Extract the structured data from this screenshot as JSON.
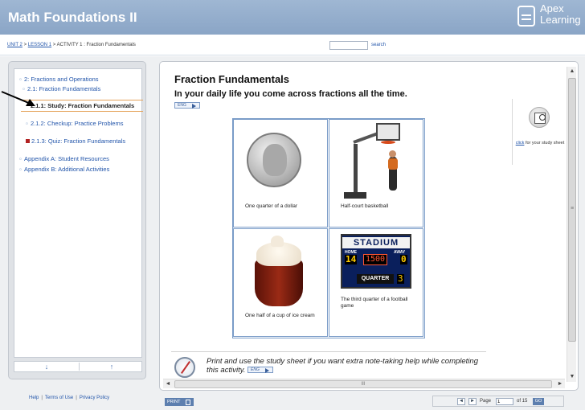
{
  "header": {
    "title": "Math Foundations II",
    "logo_line1": "Apex",
    "logo_line2": "Learning",
    "brand_color": "#8aa5c6"
  },
  "breadcrumb": {
    "unit": "UNIT 2",
    "lesson": "LESSON 1",
    "activity": "ACTIVITY 1 : Fraction Fundamentals",
    "sep": " > "
  },
  "search": {
    "placeholder": "",
    "label": "search"
  },
  "toc": {
    "items": [
      {
        "label": "2: Fractions and Operations"
      },
      {
        "label": "2.1: Fraction Fundamentals"
      },
      {
        "label": "2.1.1: Study: Fraction Fundamentals"
      },
      {
        "label": "2.1.2: Checkup: Practice Problems"
      },
      {
        "label": "2.1.3: Quiz: Fraction Fundamentals"
      },
      {
        "label": "Appendix A: Student Resources"
      },
      {
        "label": "Appendix B: Additional Activities"
      }
    ],
    "nav_down": "↓",
    "nav_up": "↑"
  },
  "footer": {
    "help": "Help",
    "terms": "Terms of Use",
    "privacy": "Privacy Policy",
    "sep": "|"
  },
  "content": {
    "title": "Fraction Fundamentals",
    "intro": "In your daily life you come across fractions all the time.",
    "eng_label": "ENG",
    "study_link": "click",
    "study_text": " for your study sheet",
    "captions": [
      "One quarter of a dollar",
      "Half-court basketball",
      "One half of a cup of ice cream",
      "The third quarter of a football game"
    ],
    "scoreboard": {
      "title": "STADIUM",
      "home": "HOME",
      "away": "AWAY",
      "home_score": "14",
      "clock": "1500",
      "away_score": "0",
      "quarter_label": "QUARTER",
      "quarter": "3"
    },
    "note": "Print and use the study sheet if you want extra note-taking help while completing this activity.",
    "hscroll_grip": "III"
  },
  "bottom": {
    "print": "PRINT",
    "page_label": "Page",
    "page_value": "1",
    "of_label": "of 15",
    "go": "GO",
    "prev": "◄",
    "next": "►"
  }
}
